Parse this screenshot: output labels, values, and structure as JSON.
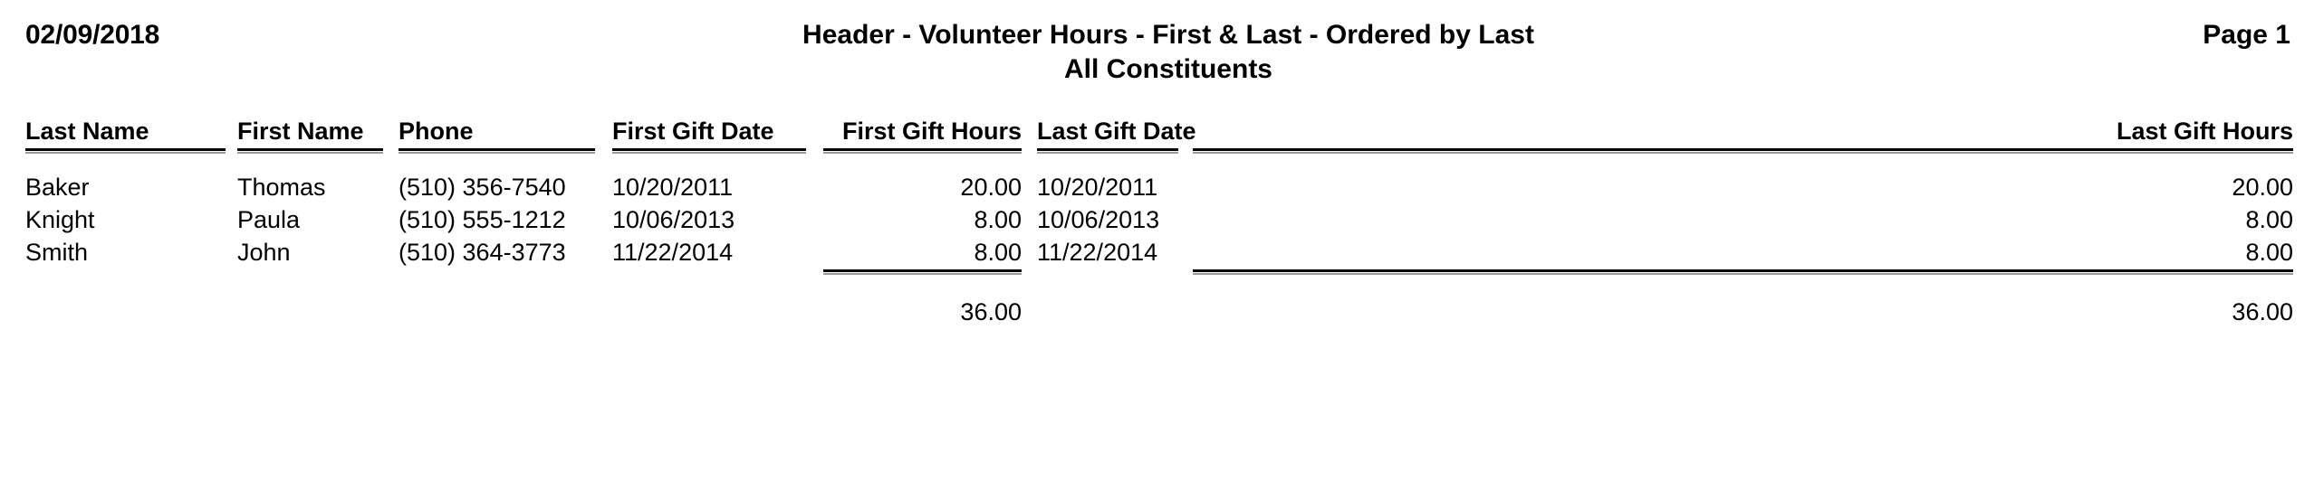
{
  "header": {
    "date": "02/09/2018",
    "title": "Header - Volunteer Hours - First & Last - Ordered by Last",
    "subtitle": "All Constituents",
    "page_label": "Page 1"
  },
  "table": {
    "columns": [
      {
        "key": "last_name",
        "label": "Last Name",
        "align": "left"
      },
      {
        "key": "first_name",
        "label": "First Name",
        "align": "left"
      },
      {
        "key": "phone",
        "label": "Phone",
        "align": "left"
      },
      {
        "key": "first_gift_date",
        "label": "First Gift Date",
        "align": "left"
      },
      {
        "key": "first_gift_hours",
        "label": "First Gift Hours",
        "align": "right"
      },
      {
        "key": "last_gift_date",
        "label": "Last Gift Date",
        "align": "left"
      },
      {
        "key": "last_gift_hours",
        "label": "Last Gift Hours",
        "align": "right"
      }
    ],
    "rows": [
      {
        "last_name": "Baker",
        "first_name": "Thomas",
        "phone": "(510) 356-7540",
        "first_gift_date": "10/20/2011",
        "first_gift_hours": "20.00",
        "last_gift_date": "10/20/2011",
        "last_gift_hours": "20.00"
      },
      {
        "last_name": "Knight",
        "first_name": "Paula",
        "phone": "(510) 555-1212",
        "first_gift_date": "10/06/2013",
        "first_gift_hours": "8.00",
        "last_gift_date": "10/06/2013",
        "last_gift_hours": "8.00"
      },
      {
        "last_name": "Smith",
        "first_name": "John",
        "phone": "(510) 364-3773",
        "first_gift_date": "11/22/2014",
        "first_gift_hours": "8.00",
        "last_gift_date": "11/22/2014",
        "last_gift_hours": "8.00"
      }
    ],
    "totals": {
      "first_gift_hours": "36.00",
      "last_gift_hours": "36.00"
    }
  },
  "colors": {
    "text": "#000000",
    "rule_dark": "#000000",
    "rule_light": "#9a9a9a",
    "background": "#ffffff"
  }
}
